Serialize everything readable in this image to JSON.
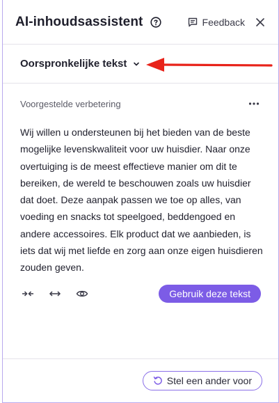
{
  "header": {
    "title": "AI-inhoudsassistent",
    "feedback_label": "Feedback"
  },
  "source": {
    "dropdown_label": "Oorspronkelijke tekst"
  },
  "suggestion": {
    "label": "Voorgestelde verbetering",
    "text": "Wij willen u ondersteunen bij het bieden van de beste mogelijke levenskwaliteit voor uw huisdier. Naar onze overtuiging is de meest effectieve manier om dit te bereiken, de wereld te beschouwen zoals uw huisdier dat doet. Deze aanpak passen we toe op alles, van voeding en snacks tot speelgoed, beddengoed en andere accessoires. Elk product dat we aanbieden, is iets dat wij met liefde en zorg aan onze eigen huisdieren zouden geven.",
    "use_button": "Gebruik deze tekst"
  },
  "footer": {
    "suggest_button": "Stel een ander voor"
  },
  "icons": {
    "help": "help-circle-icon",
    "feedback": "message-icon",
    "close": "close-icon",
    "dropdown": "chevron-down-icon",
    "more": "more-horizontal-icon",
    "shorten": "shorten-icon",
    "lengthen": "lengthen-icon",
    "preview": "eye-icon",
    "refresh": "refresh-icon",
    "annotation": "red-arrow-icon"
  },
  "colors": {
    "accent": "#7c5ce6",
    "panel_border": "#b9a9ee",
    "annotation_arrow": "#e8231a"
  }
}
